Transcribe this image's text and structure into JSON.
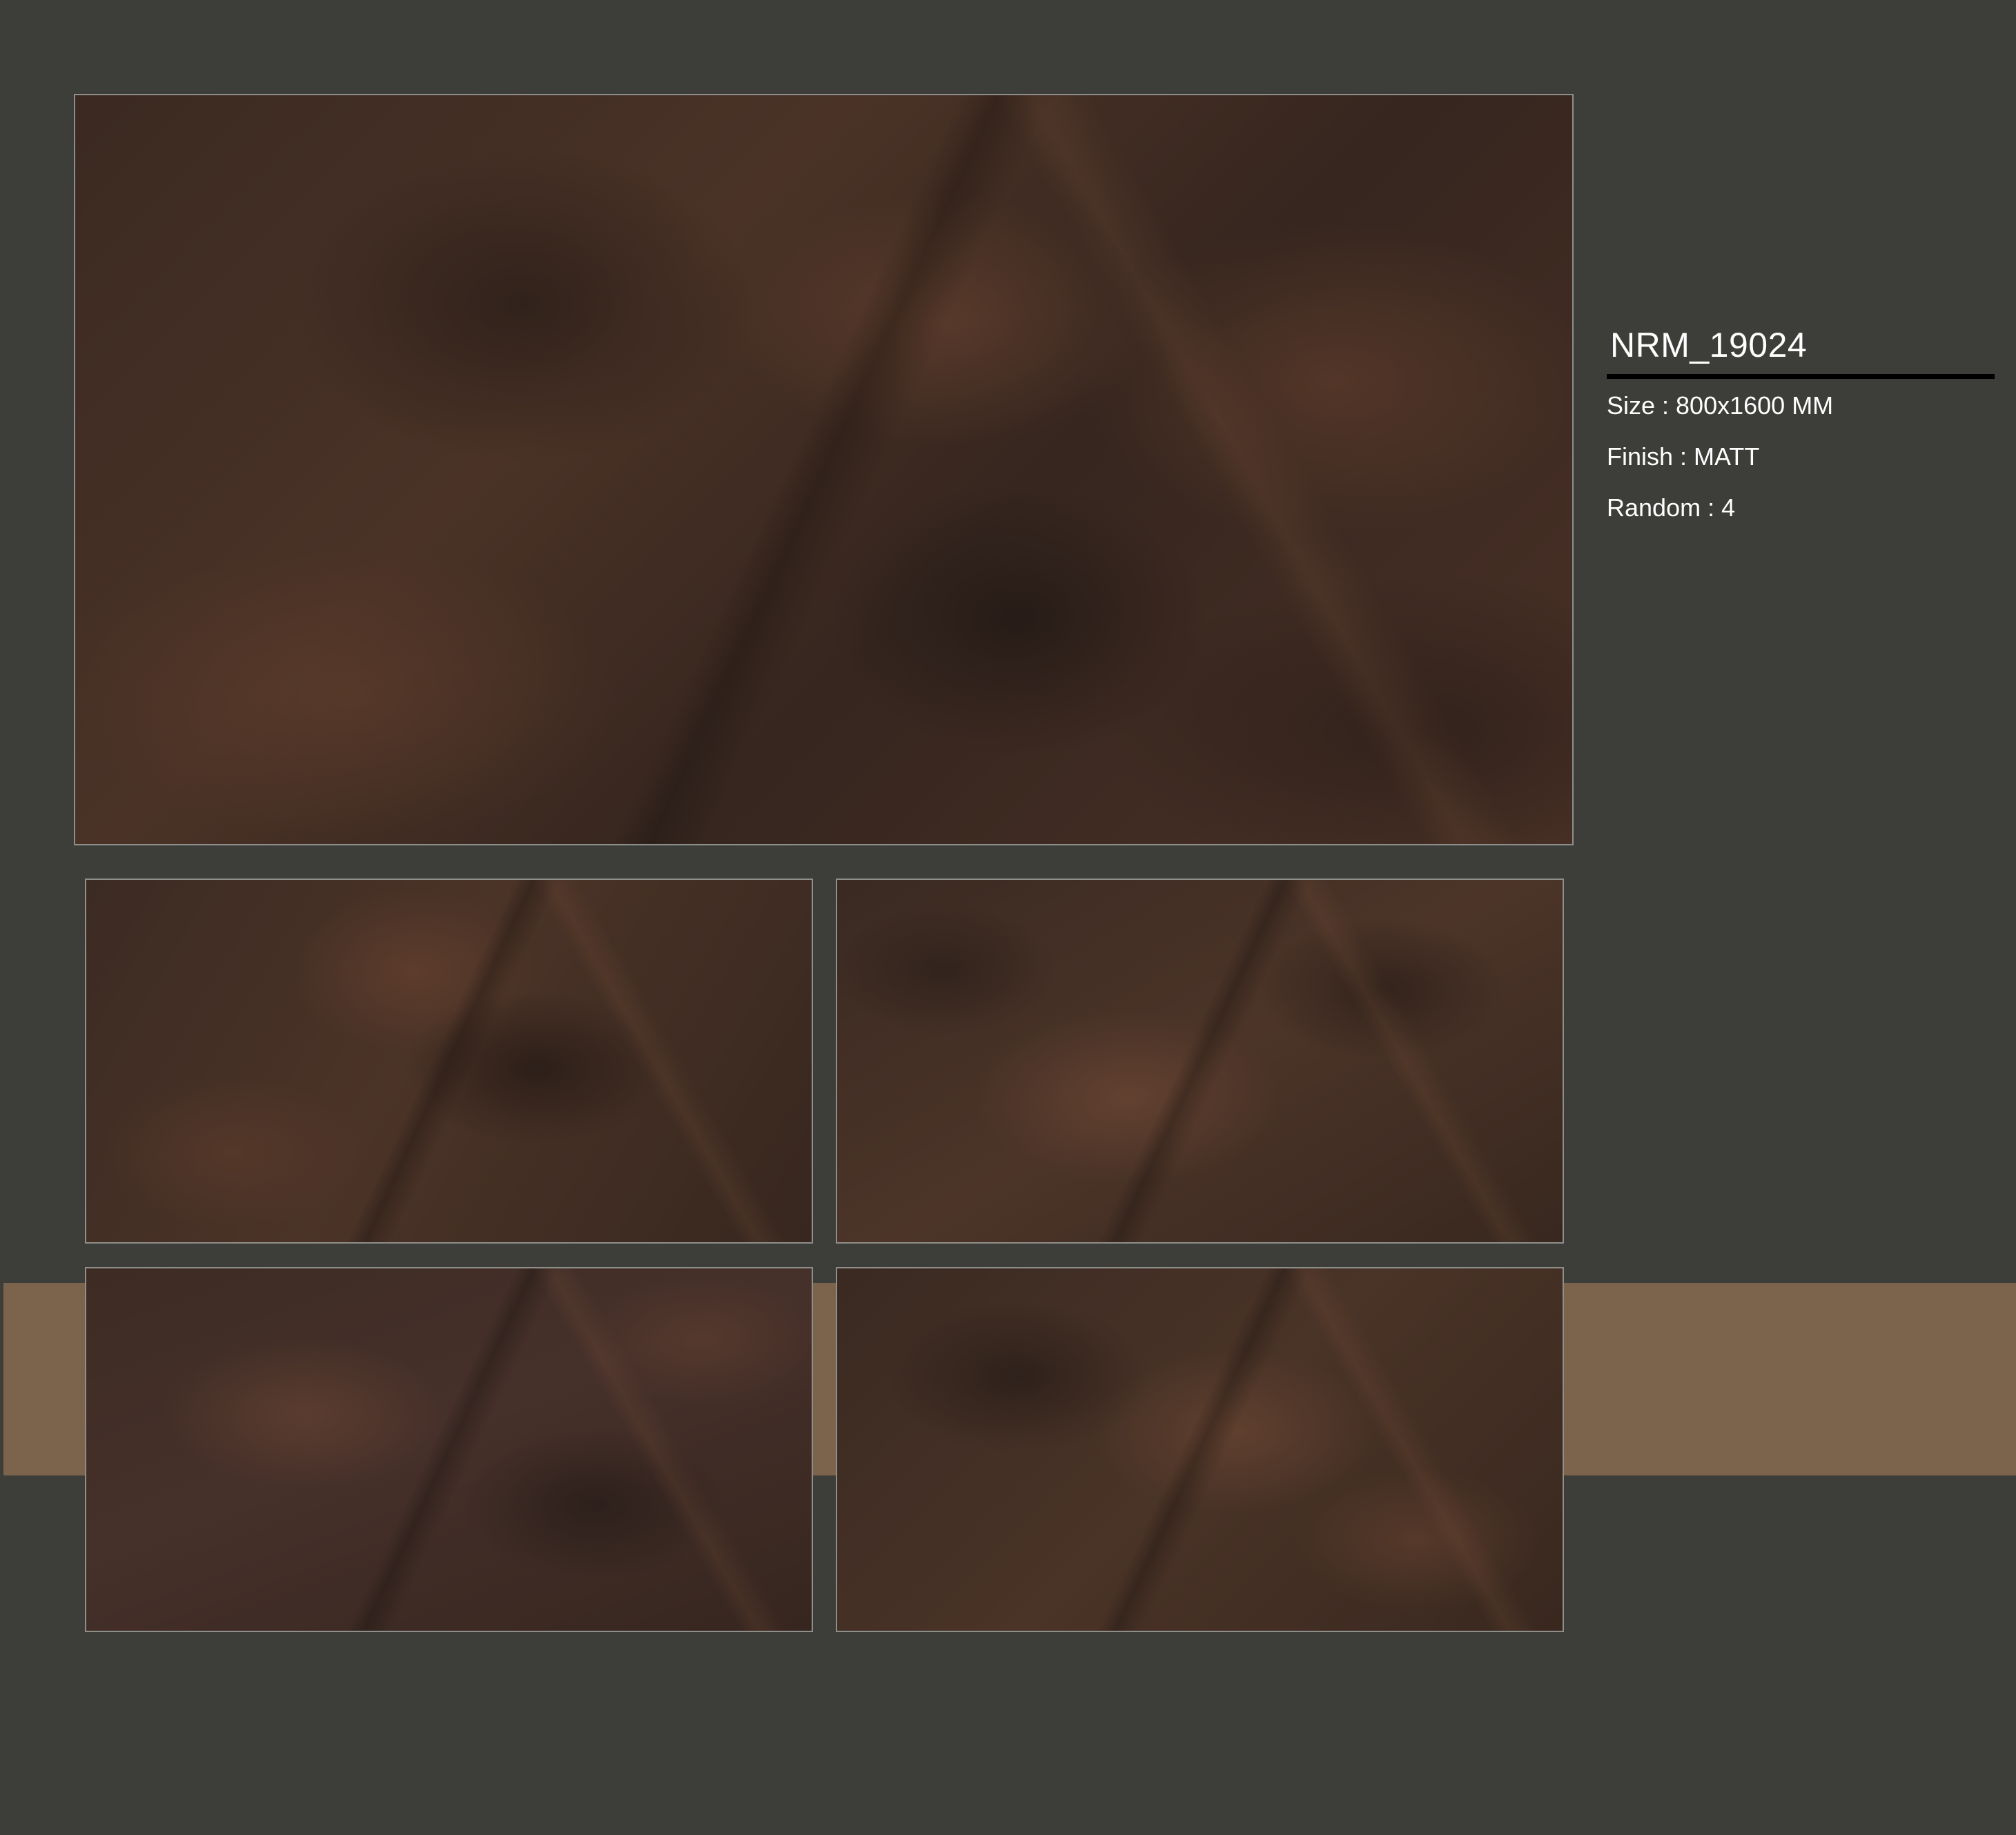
{
  "product": {
    "code": "NRM_19024",
    "specs": [
      {
        "label": "Size",
        "value": "800x1600 MM",
        "text": "Size : 800x1600 MM"
      },
      {
        "label": "Finish",
        "value": "MATT",
        "text": "Finish : MATT"
      },
      {
        "label": "Random",
        "value": "4",
        "text": "Random : 4"
      }
    ]
  },
  "colors": {
    "background": "#3d3e39",
    "accent_band": "#7c644c",
    "tile_base": "#3a2922",
    "tile_border": "#8e8e8a",
    "text": "#ffffff",
    "rule": "#000000"
  },
  "tile_variations_shown": 4
}
